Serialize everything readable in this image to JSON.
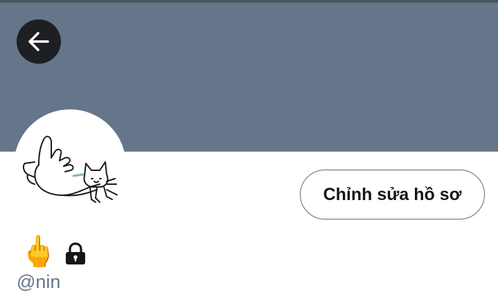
{
  "header": {
    "banner_color": "#66768a",
    "back_icon": "arrow-left-icon"
  },
  "profile": {
    "avatar_icon": "cat-and-hand-drawing",
    "edit_button_label": "Chỉnh sửa hồ sơ",
    "display_name": "🖕",
    "protected_icon": "lock-icon",
    "handle": "@nin"
  }
}
